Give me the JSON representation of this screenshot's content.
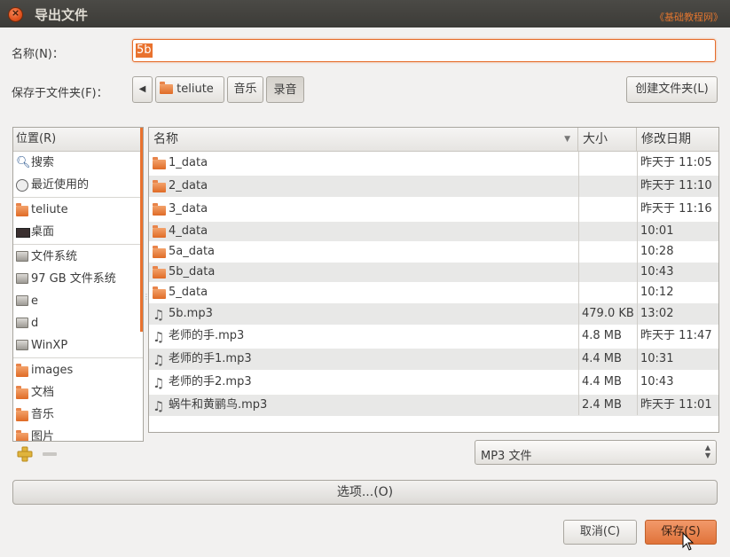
{
  "window": {
    "title": "导出文件",
    "watermark": "《基础教程网》"
  },
  "name_field": {
    "label": "名称(N)：",
    "value": "5b"
  },
  "save_in": {
    "label": "保存于文件夹(F)：",
    "path": [
      "teliute",
      "音乐",
      "录音"
    ],
    "create_folder": "创建文件夹(L)"
  },
  "places": {
    "header": "位置(R)",
    "items": [
      {
        "label": "搜索",
        "icon": "search-icon"
      },
      {
        "label": "最近使用的",
        "icon": "clock-icon"
      },
      {
        "label": "teliute",
        "icon": "home-folder-icon"
      },
      {
        "label": "桌面",
        "icon": "desktop-icon"
      },
      {
        "label": "文件系统",
        "icon": "drive-icon"
      },
      {
        "label": "97 GB 文件系统",
        "icon": "drive-icon"
      },
      {
        "label": "e",
        "icon": "drive-icon"
      },
      {
        "label": "d",
        "icon": "drive-icon"
      },
      {
        "label": "WinXP",
        "icon": "drive-icon"
      },
      {
        "label": "images",
        "icon": "folder-icon"
      },
      {
        "label": "文档",
        "icon": "documents-folder-icon"
      },
      {
        "label": "音乐",
        "icon": "music-folder-icon"
      },
      {
        "label": "图片",
        "icon": "pictures-folder-icon"
      }
    ]
  },
  "files": {
    "columns": {
      "name": "名称",
      "size": "大小",
      "modified": "修改日期"
    },
    "rows": [
      {
        "name": "1_data",
        "size": "",
        "modified": "昨天于 11:05",
        "type": "folder"
      },
      {
        "name": "2_data",
        "size": "",
        "modified": "昨天于 11:10",
        "type": "folder"
      },
      {
        "name": "3_data",
        "size": "",
        "modified": "昨天于 11:16",
        "type": "folder"
      },
      {
        "name": "4_data",
        "size": "",
        "modified": "10:01",
        "type": "folder"
      },
      {
        "name": "5a_data",
        "size": "",
        "modified": "10:28",
        "type": "folder"
      },
      {
        "name": "5b_data",
        "size": "",
        "modified": "10:43",
        "type": "folder"
      },
      {
        "name": "5_data",
        "size": "",
        "modified": "10:12",
        "type": "folder"
      },
      {
        "name": "5b.mp3",
        "size": "479.0 KB",
        "modified": "13:02",
        "type": "audio"
      },
      {
        "name": "老师的手.mp3",
        "size": "4.8 MB",
        "modified": "昨天于 11:47",
        "type": "audio"
      },
      {
        "name": "老师的手1.mp3",
        "size": "4.4 MB",
        "modified": "10:31",
        "type": "audio"
      },
      {
        "name": "老师的手2.mp3",
        "size": "4.4 MB",
        "modified": "10:43",
        "type": "audio"
      },
      {
        "name": "蜗牛和黄鹂鸟.mp3",
        "size": "2.4 MB",
        "modified": "昨天于 11:01",
        "type": "audio"
      }
    ]
  },
  "filter": {
    "selected": "MP3 文件"
  },
  "options_label": "选项...(O)",
  "buttons": {
    "cancel": "取消(C)",
    "save": "保存(S)"
  },
  "colors": {
    "accent": "#e9722e",
    "titlebar": "#3c3b37"
  }
}
